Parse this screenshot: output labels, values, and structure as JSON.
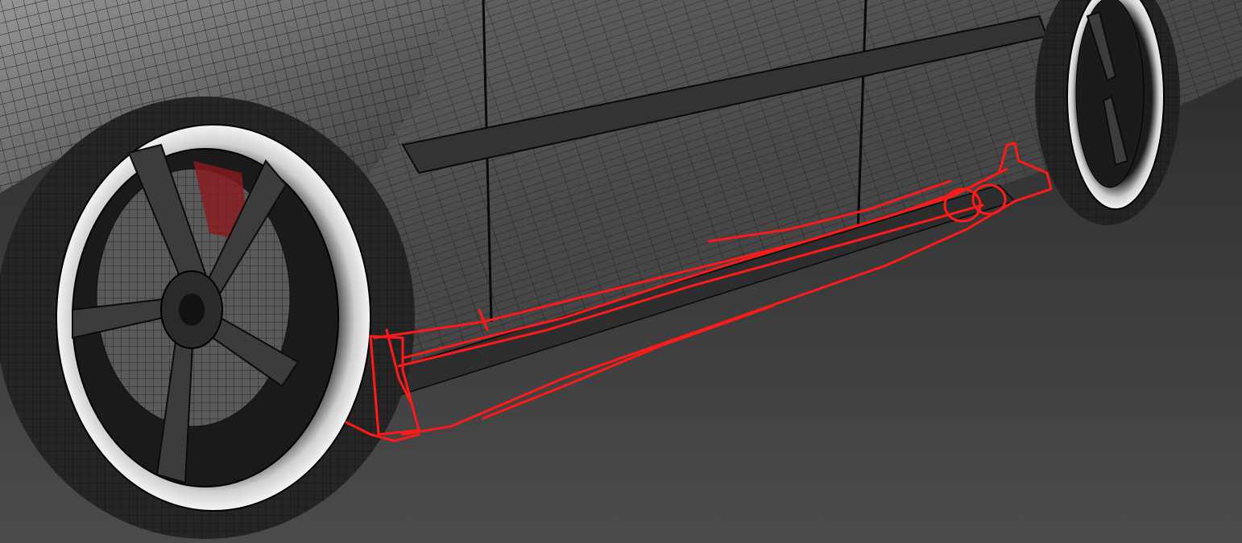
{
  "scene": {
    "subject": "car-side-skirt-wireframe",
    "colors": {
      "background_top": "#2e2e2e",
      "background_bottom": "#4a4a4a",
      "body_panel": "#5a5a5a",
      "body_panel_dark": "#3c3c3c",
      "wire": "#111111",
      "tire": "#2b2b2b",
      "rim_highlight": "#f2f2f2",
      "brake_accent": "#c0202a",
      "sketch": "#ff1a1a"
    }
  }
}
